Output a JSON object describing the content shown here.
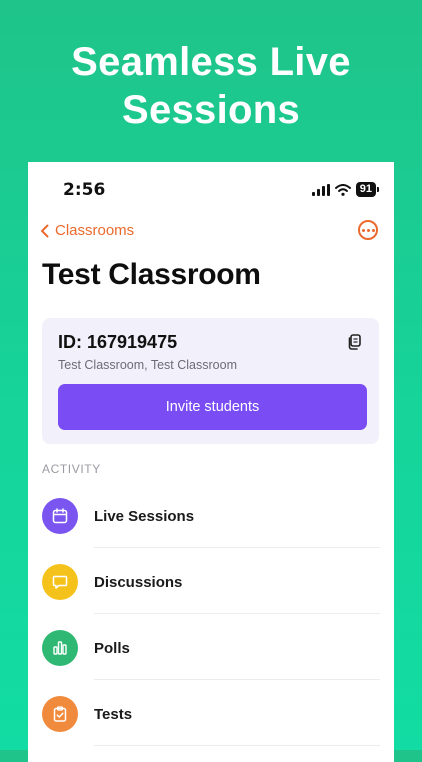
{
  "headline": {
    "line1": "Seamless Live",
    "line2": "Sessions"
  },
  "status_bar": {
    "time": "2:56",
    "battery": "91"
  },
  "navbar": {
    "back_label": "Classrooms"
  },
  "page": {
    "title": "Test Classroom"
  },
  "class_card": {
    "id_text": "ID: 167919475",
    "subtitle": "Test Classroom, Test Classroom",
    "invite_label": "Invite students"
  },
  "activity": {
    "section_label": "ACTIVITY",
    "items": [
      {
        "label": "Live Sessions",
        "icon": "calendar-icon",
        "color": "#7b55f0"
      },
      {
        "label": "Discussions",
        "icon": "chat-bubble-icon",
        "color": "#f5c21b"
      },
      {
        "label": "Polls",
        "icon": "bar-chart-icon",
        "color": "#2fb873"
      },
      {
        "label": "Tests",
        "icon": "clipboard-check-icon",
        "color": "#f08a3c"
      }
    ]
  },
  "colors": {
    "accent": "#ea6a2e",
    "primary_button": "#7a4cf4",
    "background": "#16d49a"
  }
}
